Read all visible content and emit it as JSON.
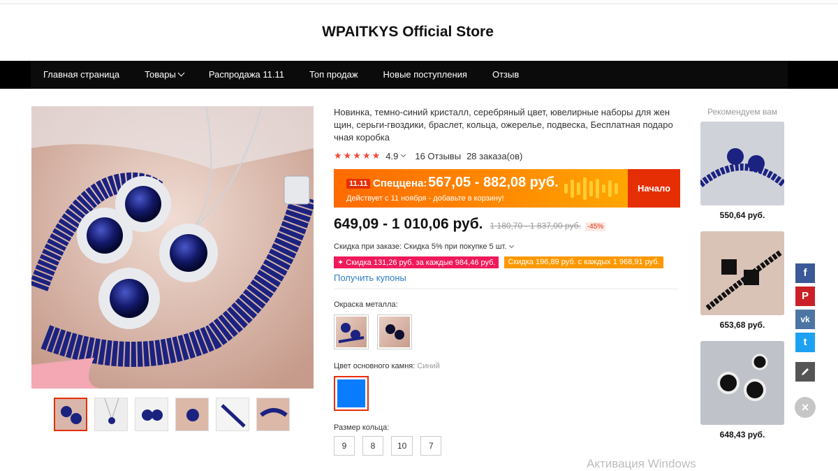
{
  "store": {
    "title": "WPAITKYS Official Store"
  },
  "nav": {
    "items": [
      "Главная страница",
      "Товары",
      "Распродажа 11.11",
      "Топ продаж",
      "Новые поступления",
      "Отзыв"
    ]
  },
  "product": {
    "title": "Новинка, темно-синий кристалл, серебряный цвет, ювелирные наборы для жен щин, серьги-гвоздики, браслет, кольца, ожерелье, подвеска, Бесплатная подаро чная коробка",
    "stars": "★★★★★",
    "rating": "4.9",
    "reviews": "16 Отзывы",
    "orders": "28 заказа(ов)"
  },
  "promo": {
    "badge": "11.11",
    "label": "Спеццена:",
    "price": "567,05 - 882,08 руб.",
    "sub": "Действует с 11 ноября - добавьте в корзину!",
    "action": "Начало"
  },
  "pricing": {
    "price": "649,09 - 1 010,06 руб.",
    "old_price": "1 180,70 - 1 837,00 руб.",
    "discount": "-45%",
    "order_discount": "Скидка при заказе: Скидка 5% при покупке 5 шт.",
    "coupon1": "✦ Скидка 131,26 руб. за каждые 984,46 руб.",
    "coupon2": "Скидка 196,89 руб. с каждых 1 968,91 руб.",
    "get_coupons": "Получить купоны"
  },
  "options": {
    "metal_label": "Окраска металла:",
    "stone_label": "Цвет основного камня:",
    "stone_value": "Синий",
    "stone_color": "#0a7cff",
    "size_label": "Размер кольца:",
    "sizes": [
      "9",
      "8",
      "10",
      "7"
    ]
  },
  "recommended": {
    "title": "Рекомендуем вам",
    "items": [
      {
        "price": "550,64 руб."
      },
      {
        "price": "653,68 руб."
      },
      {
        "price": "648,43 руб."
      }
    ]
  },
  "social": {
    "facebook": "f",
    "pinterest": "P",
    "vk": "vk",
    "twitter": "t",
    "close": "×"
  },
  "watermark": "Активация Windows",
  "colors": {
    "accent": "#e62e04",
    "link": "#2f7ec7",
    "promo": "#ff8c00"
  }
}
